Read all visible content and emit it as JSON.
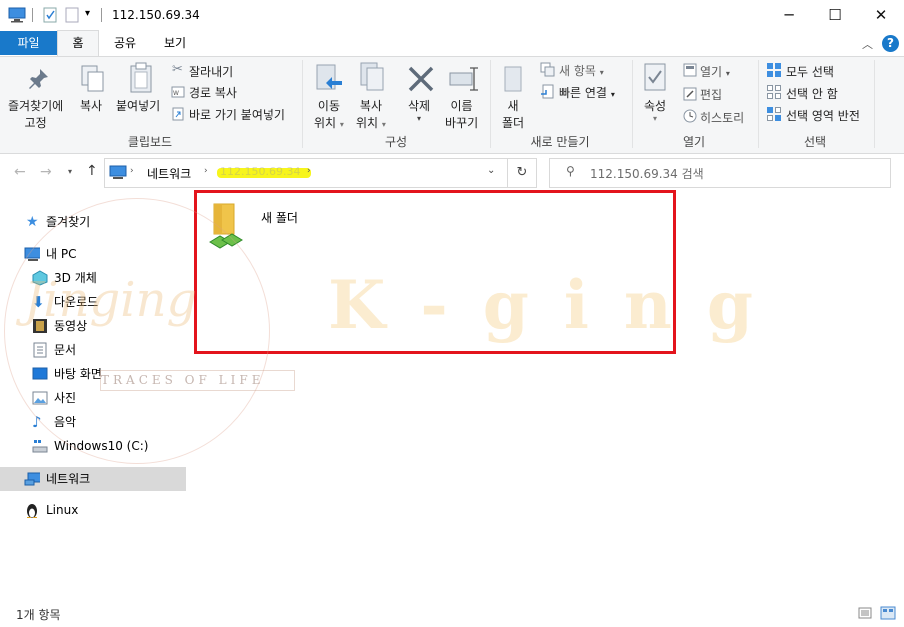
{
  "window": {
    "title": "112.150.69.34",
    "minimize_glyph": "─",
    "maximize_glyph": "☐",
    "close_glyph": "✕"
  },
  "ribbon_tabs": [
    "파일",
    "홈",
    "공유",
    "보기"
  ],
  "ribbon": {
    "clipboard": {
      "pin": "즐겨찾기에\n고정",
      "pin_line1": "즐겨찾기에",
      "pin_line2": "고정",
      "copy": "복사",
      "paste": "붙여넣기",
      "cut": "잘라내기",
      "copy_path": "경로 복사",
      "paste_shortcut": "바로 가기 붙여넣기",
      "group_label": "클립보드"
    },
    "organize": {
      "move_line1": "이동",
      "move_line2": "위치",
      "copyto_line1": "복사",
      "copyto_line2": "위치",
      "delete": "삭제",
      "rename_line1": "이름",
      "rename_line2": "바꾸기",
      "group_label": "구성"
    },
    "new": {
      "folder_line1": "새",
      "folder_line2": "폴더",
      "new_item": "새 항목",
      "easy_access": "빠른 연결",
      "group_label": "새로 만들기"
    },
    "open": {
      "properties": "속성",
      "open": "열기",
      "edit": "편집",
      "history": "히스토리",
      "group_label": "열기"
    },
    "select": {
      "select_all": "모두 선택",
      "select_none": "선택 안 함",
      "invert": "선택 영역 반전",
      "group_label": "선택"
    },
    "help_glyph": "?"
  },
  "address": {
    "crumbs": [
      "네트워크",
      "112.150.69.34"
    ],
    "search_placeholder": "112.150.69.34 검색"
  },
  "nav": {
    "quick_access": "즐겨찾기",
    "this_pc": "내 PC",
    "objects3d": "3D 개체",
    "downloads": "다운로드",
    "videos": "동영상",
    "documents": "문서",
    "desktop": "바탕 화면",
    "pictures": "사진",
    "music": "음악",
    "drive_c": "Windows10 (C:)",
    "network": "네트워크",
    "linux": "Linux"
  },
  "content": {
    "items": [
      {
        "name": "새 폴더"
      }
    ]
  },
  "status": {
    "count": "1개 항목"
  },
  "watermark": {
    "brand": "K - g i n g",
    "script": "Jinging",
    "tagline": "TRACES OF LIFE"
  },
  "colors": {
    "accent": "#1979ca",
    "highlight_box": "#e3141c",
    "selected_nav": "#d9d9d9",
    "folder": "#f0c44a"
  }
}
